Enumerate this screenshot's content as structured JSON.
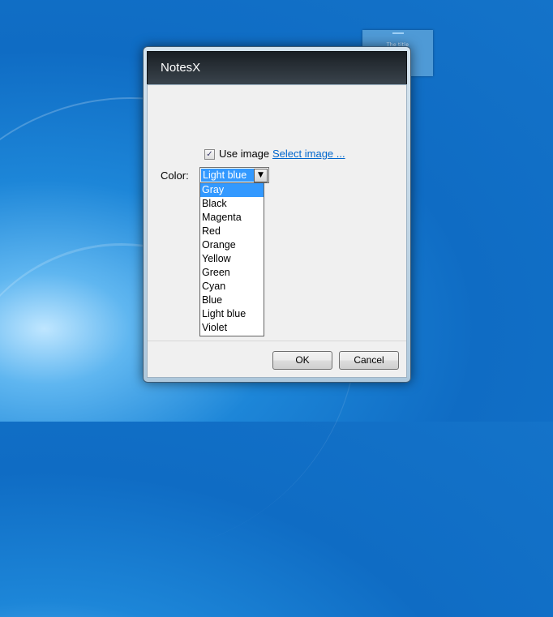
{
  "desktop": {
    "widget": {
      "title": "The title",
      "text": "Some text here"
    }
  },
  "dialog": {
    "title": "NotesX",
    "use_image": {
      "checked": true,
      "label": "Use image",
      "link": "Select image ..."
    },
    "color": {
      "label": "Color:",
      "selected": "Light blue",
      "options": [
        "Gray",
        "Black",
        "Magenta",
        "Red",
        "Orange",
        "Yellow",
        "Green",
        "Cyan",
        "Blue",
        "Light blue",
        "Violet"
      ],
      "highlighted": "Gray"
    },
    "buttons": {
      "ok": "OK",
      "cancel": "Cancel"
    }
  },
  "colors": {
    "accent": "#3399ff",
    "link": "#0066cc",
    "titlebar": "#1a1f24"
  }
}
